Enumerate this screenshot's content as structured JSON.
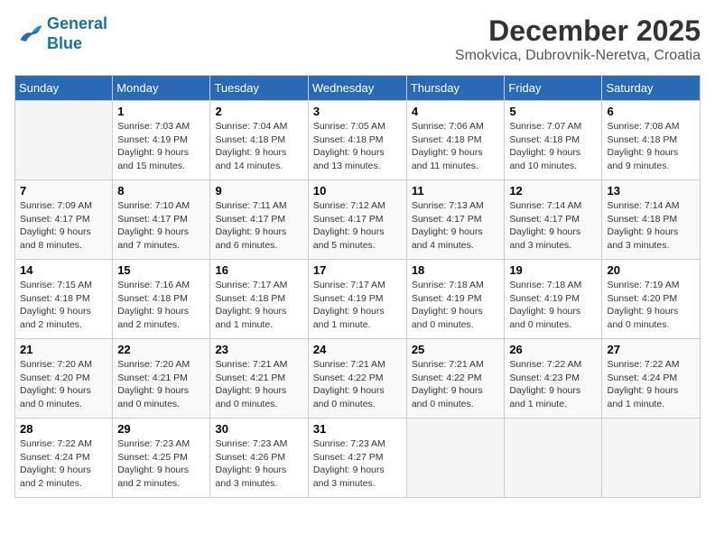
{
  "header": {
    "logo_line1": "General",
    "logo_line2": "Blue",
    "month": "December 2025",
    "location": "Smokvica, Dubrovnik-Neretva, Croatia"
  },
  "weekdays": [
    "Sunday",
    "Monday",
    "Tuesday",
    "Wednesday",
    "Thursday",
    "Friday",
    "Saturday"
  ],
  "weeks": [
    [
      {
        "day": "",
        "info": ""
      },
      {
        "day": "1",
        "info": "Sunrise: 7:03 AM\nSunset: 4:19 PM\nDaylight: 9 hours\nand 15 minutes."
      },
      {
        "day": "2",
        "info": "Sunrise: 7:04 AM\nSunset: 4:18 PM\nDaylight: 9 hours\nand 14 minutes."
      },
      {
        "day": "3",
        "info": "Sunrise: 7:05 AM\nSunset: 4:18 PM\nDaylight: 9 hours\nand 13 minutes."
      },
      {
        "day": "4",
        "info": "Sunrise: 7:06 AM\nSunset: 4:18 PM\nDaylight: 9 hours\nand 11 minutes."
      },
      {
        "day": "5",
        "info": "Sunrise: 7:07 AM\nSunset: 4:18 PM\nDaylight: 9 hours\nand 10 minutes."
      },
      {
        "day": "6",
        "info": "Sunrise: 7:08 AM\nSunset: 4:18 PM\nDaylight: 9 hours\nand 9 minutes."
      }
    ],
    [
      {
        "day": "7",
        "info": "Sunrise: 7:09 AM\nSunset: 4:17 PM\nDaylight: 9 hours\nand 8 minutes."
      },
      {
        "day": "8",
        "info": "Sunrise: 7:10 AM\nSunset: 4:17 PM\nDaylight: 9 hours\nand 7 minutes."
      },
      {
        "day": "9",
        "info": "Sunrise: 7:11 AM\nSunset: 4:17 PM\nDaylight: 9 hours\nand 6 minutes."
      },
      {
        "day": "10",
        "info": "Sunrise: 7:12 AM\nSunset: 4:17 PM\nDaylight: 9 hours\nand 5 minutes."
      },
      {
        "day": "11",
        "info": "Sunrise: 7:13 AM\nSunset: 4:17 PM\nDaylight: 9 hours\nand 4 minutes."
      },
      {
        "day": "12",
        "info": "Sunrise: 7:14 AM\nSunset: 4:17 PM\nDaylight: 9 hours\nand 3 minutes."
      },
      {
        "day": "13",
        "info": "Sunrise: 7:14 AM\nSunset: 4:18 PM\nDaylight: 9 hours\nand 3 minutes."
      }
    ],
    [
      {
        "day": "14",
        "info": "Sunrise: 7:15 AM\nSunset: 4:18 PM\nDaylight: 9 hours\nand 2 minutes."
      },
      {
        "day": "15",
        "info": "Sunrise: 7:16 AM\nSunset: 4:18 PM\nDaylight: 9 hours\nand 2 minutes."
      },
      {
        "day": "16",
        "info": "Sunrise: 7:17 AM\nSunset: 4:18 PM\nDaylight: 9 hours\nand 1 minute."
      },
      {
        "day": "17",
        "info": "Sunrise: 7:17 AM\nSunset: 4:19 PM\nDaylight: 9 hours\nand 1 minute."
      },
      {
        "day": "18",
        "info": "Sunrise: 7:18 AM\nSunset: 4:19 PM\nDaylight: 9 hours\nand 0 minutes."
      },
      {
        "day": "19",
        "info": "Sunrise: 7:18 AM\nSunset: 4:19 PM\nDaylight: 9 hours\nand 0 minutes."
      },
      {
        "day": "20",
        "info": "Sunrise: 7:19 AM\nSunset: 4:20 PM\nDaylight: 9 hours\nand 0 minutes."
      }
    ],
    [
      {
        "day": "21",
        "info": "Sunrise: 7:20 AM\nSunset: 4:20 PM\nDaylight: 9 hours\nand 0 minutes."
      },
      {
        "day": "22",
        "info": "Sunrise: 7:20 AM\nSunset: 4:21 PM\nDaylight: 9 hours\nand 0 minutes."
      },
      {
        "day": "23",
        "info": "Sunrise: 7:21 AM\nSunset: 4:21 PM\nDaylight: 9 hours\nand 0 minutes."
      },
      {
        "day": "24",
        "info": "Sunrise: 7:21 AM\nSunset: 4:22 PM\nDaylight: 9 hours\nand 0 minutes."
      },
      {
        "day": "25",
        "info": "Sunrise: 7:21 AM\nSunset: 4:22 PM\nDaylight: 9 hours\nand 0 minutes."
      },
      {
        "day": "26",
        "info": "Sunrise: 7:22 AM\nSunset: 4:23 PM\nDaylight: 9 hours\nand 1 minute."
      },
      {
        "day": "27",
        "info": "Sunrise: 7:22 AM\nSunset: 4:24 PM\nDaylight: 9 hours\nand 1 minute."
      }
    ],
    [
      {
        "day": "28",
        "info": "Sunrise: 7:22 AM\nSunset: 4:24 PM\nDaylight: 9 hours\nand 2 minutes."
      },
      {
        "day": "29",
        "info": "Sunrise: 7:23 AM\nSunset: 4:25 PM\nDaylight: 9 hours\nand 2 minutes."
      },
      {
        "day": "30",
        "info": "Sunrise: 7:23 AM\nSunset: 4:26 PM\nDaylight: 9 hours\nand 3 minutes."
      },
      {
        "day": "31",
        "info": "Sunrise: 7:23 AM\nSunset: 4:27 PM\nDaylight: 9 hours\nand 3 minutes."
      },
      {
        "day": "",
        "info": ""
      },
      {
        "day": "",
        "info": ""
      },
      {
        "day": "",
        "info": ""
      }
    ]
  ]
}
